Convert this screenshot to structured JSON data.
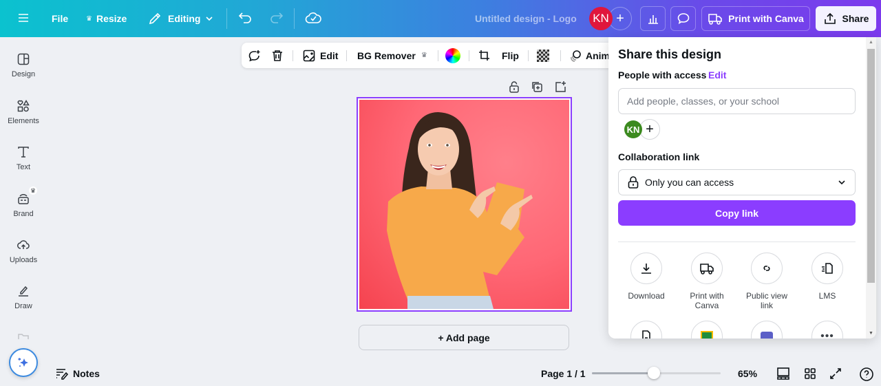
{
  "topbar": {
    "menu_icon": "hamburger-icon",
    "file_label": "File",
    "resize_label": "Resize",
    "editing_label": "Editing",
    "document_title": "Untitled design - Logo",
    "avatar_initials": "KN",
    "avatar_color": "#e0163c",
    "add_collaborator": "+",
    "print_label": "Print with Canva",
    "share_label": "Share"
  },
  "sidebar": {
    "items": [
      {
        "label": "Design",
        "icon": "design-icon"
      },
      {
        "label": "Elements",
        "icon": "elements-icon"
      },
      {
        "label": "Text",
        "icon": "text-icon"
      },
      {
        "label": "Brand",
        "icon": "brand-icon"
      },
      {
        "label": "Uploads",
        "icon": "uploads-icon"
      },
      {
        "label": "Draw",
        "icon": "draw-icon"
      }
    ]
  },
  "context_toolbar": {
    "edit_label": "Edit",
    "bg_remover_label": "BG Remover",
    "flip_label": "Flip",
    "animate_label": "Anim"
  },
  "canvas": {
    "add_page_label": "+ Add page",
    "image_description": "Woman in orange sweater pointing on pink background",
    "selection_color": "#8b3dff"
  },
  "footer": {
    "notes_label": "Notes",
    "page_indicator": "Page 1 / 1",
    "zoom_percent": "65%",
    "zoom_value": 0.48
  },
  "share_panel": {
    "title": "Share this design",
    "people_label": "People with access",
    "edit_link": "Edit",
    "input_placeholder": "Add people, classes, or your school",
    "member_initials": "KN",
    "member_color": "#3c8a1f",
    "add_member": "+",
    "collab_label": "Collaboration link",
    "access_value": "Only you can access",
    "copy_label": "Copy link",
    "accent_color": "#8b3dff",
    "options": [
      {
        "label": "Download",
        "icon": "download-icon"
      },
      {
        "label": "Print with Canva",
        "icon": "truck-icon"
      },
      {
        "label": "Public view link",
        "icon": "link-icon"
      },
      {
        "label": "LMS",
        "icon": "lms-icon"
      }
    ],
    "options_row2": [
      {
        "icon": "document-icon"
      },
      {
        "icon": "google-classroom-icon"
      },
      {
        "icon": "microsoft-teams-icon"
      },
      {
        "icon": "more-icon"
      }
    ]
  }
}
